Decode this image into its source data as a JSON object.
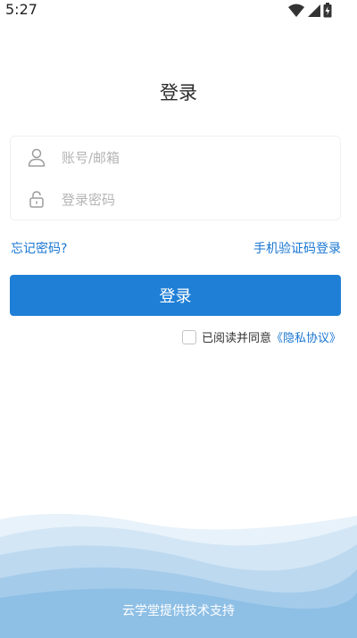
{
  "status_bar": {
    "time": "5:27",
    "icons": [
      "wifi-icon",
      "signal-icon",
      "battery-icon"
    ]
  },
  "page": {
    "title": "登录"
  },
  "form": {
    "account_placeholder": "账号/邮箱",
    "password_placeholder": "登录密码",
    "account_icon": "user-icon",
    "password_icon": "lock-icon"
  },
  "links": {
    "forgot_password": "忘记密码?",
    "sms_login": "手机验证码登录"
  },
  "login_button": "登录",
  "agreement": {
    "text": "已阅读并同意",
    "link": "《隐私协议》",
    "checked": false
  },
  "footer": {
    "text": "云学堂提供技术支持"
  },
  "colors": {
    "accent": "#1f7fd6",
    "link": "#1976d2",
    "wave_light": "#dcebf7",
    "wave_mid": "#b9d6ef",
    "wave_dark": "#8fbfe6"
  }
}
